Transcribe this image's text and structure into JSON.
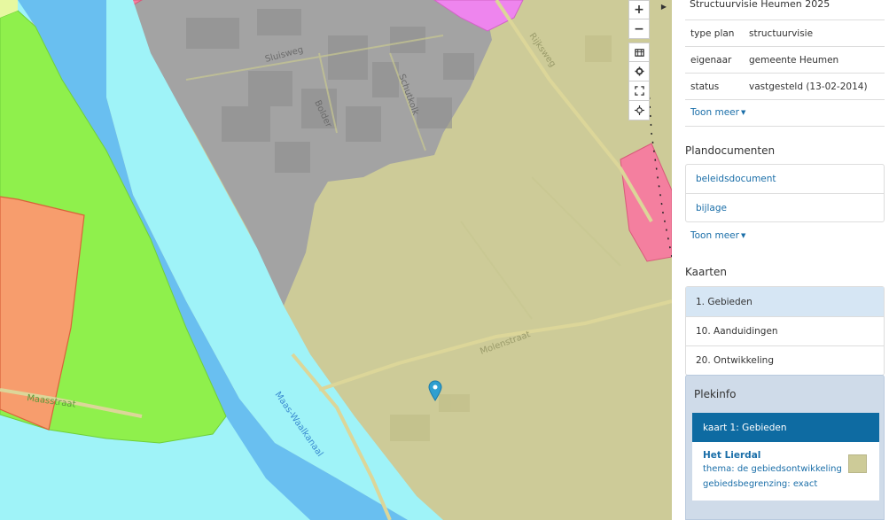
{
  "map": {
    "colors": {
      "gebied": "#cdcb98",
      "bedrijven": "#a3a3a3",
      "water": "#9ff3f8",
      "river_channel": "#69bff0",
      "groen": "#8ff04c",
      "wonen": "#f79d6d",
      "roze": "#f47f9f",
      "magenta": "#ee85ee",
      "road": "#dcd699",
      "marker": "#2e9fd0"
    },
    "street_labels": {
      "sluisweg": "Sluisweg",
      "bolder": "Bolder",
      "schutkolk": "Schutkolk",
      "rijksweg": "Rijksweg",
      "molenstraat": "Molenstraat",
      "maasstraat": "Maasstraat",
      "maas_waalkanaal": "Maas-Waalkanaal"
    },
    "controls": {
      "zoom_in": "+",
      "zoom_out": "−",
      "layers_icon": "layers-icon",
      "settings_icon": "gear-icon",
      "fullscreen_icon": "fullscreen-icon",
      "locate_icon": "crosshair-icon",
      "collapse_icon": "caret-right-icon"
    }
  },
  "panel": {
    "plan_title": "Structuurvisie Heumen 2025",
    "properties": [
      {
        "key": "type plan",
        "value": "structuurvisie"
      },
      {
        "key": "eigenaar",
        "value": "gemeente Heumen"
      },
      {
        "key": "status",
        "value": "vastgesteld (13-02-2014)"
      }
    ],
    "toon_meer_1": "Toon meer",
    "plandocumenten_title": "Plandocumenten",
    "documents": [
      "beleidsdocument",
      "bijlage"
    ],
    "toon_meer_2": "Toon meer",
    "kaarten_title": "Kaarten",
    "kaarten": [
      {
        "label": "1. Gebieden",
        "active": true
      },
      {
        "label": "10. Aanduidingen",
        "active": false
      },
      {
        "label": "20. Ontwikkeling",
        "active": false
      }
    ],
    "plekinfo": {
      "title": "Plekinfo",
      "tab": "kaart 1: Gebieden",
      "name": "Het Lierdal",
      "thema": "thema: de gebiedsontwikkeling",
      "begrenzing": "gebiedsbegrenzing: exact",
      "swatch_color": "#cdcb98"
    }
  }
}
